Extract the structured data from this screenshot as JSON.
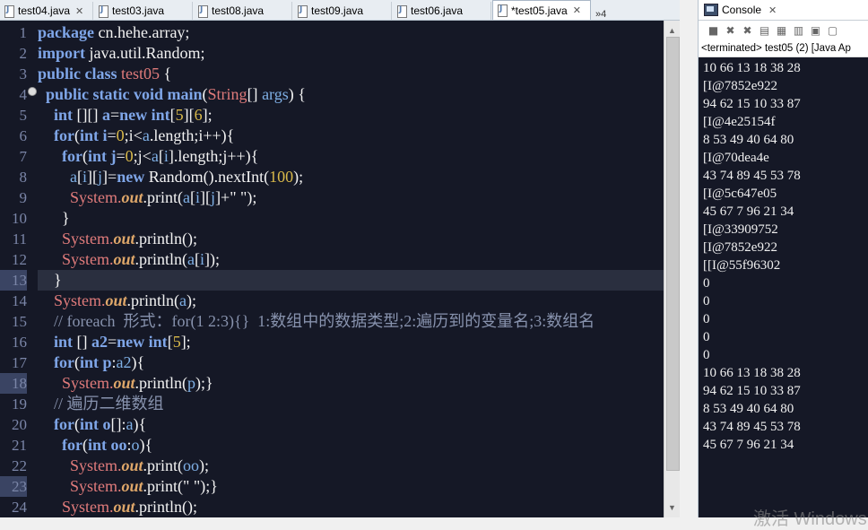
{
  "editor": {
    "tabs": [
      {
        "label": "test04.java",
        "close": "✕",
        "active": false
      },
      {
        "label": "test03.java",
        "close": "",
        "active": false
      },
      {
        "label": "test08.java",
        "close": "",
        "active": false
      },
      {
        "label": "test09.java",
        "close": "",
        "active": false
      },
      {
        "label": "test06.java",
        "close": "",
        "active": false
      },
      {
        "label": "*test05.java",
        "close": "✕",
        "active": true
      }
    ],
    "overflow_label": "»4",
    "line_numbers": [
      "1",
      "2",
      "3",
      "4",
      "5",
      "6",
      "7",
      "8",
      "9",
      "10",
      "11",
      "12",
      "13",
      "14",
      "15",
      "16",
      "17",
      "18",
      "19",
      "20",
      "21",
      "22",
      "23",
      "24"
    ],
    "lines": [
      [
        {
          "t": "package",
          "c": "kw"
        },
        {
          "t": " cn.hehe.array;",
          "c": "ty"
        }
      ],
      [
        {
          "t": "import",
          "c": "kw"
        },
        {
          "t": " java.util.Random;",
          "c": "ty"
        }
      ],
      [
        {
          "t": "public class",
          "c": "kw"
        },
        {
          "t": " ",
          "c": "ty"
        },
        {
          "t": "test05",
          "c": "cls"
        },
        {
          "t": " {",
          "c": "ty"
        }
      ],
      [
        {
          "t": "  ",
          "c": "ty"
        },
        {
          "t": "public static void",
          "c": "kw"
        },
        {
          "t": " main",
          "c": "kw"
        },
        {
          "t": "(",
          "c": "ty"
        },
        {
          "t": "String",
          "c": "cls"
        },
        {
          "t": "[] ",
          "c": "ty"
        },
        {
          "t": "args",
          "c": "var"
        },
        {
          "t": ") {",
          "c": "ty"
        }
      ],
      [
        {
          "t": "    ",
          "c": "ty"
        },
        {
          "t": "int",
          "c": "kw"
        },
        {
          "t": " [][] ",
          "c": "ty"
        },
        {
          "t": "a",
          "c": "kw"
        },
        {
          "t": "=",
          "c": "ty"
        },
        {
          "t": "new int",
          "c": "kw"
        },
        {
          "t": "[",
          "c": "ty"
        },
        {
          "t": "5",
          "c": "num"
        },
        {
          "t": "][",
          "c": "ty"
        },
        {
          "t": "6",
          "c": "num"
        },
        {
          "t": "];",
          "c": "ty"
        }
      ],
      [
        {
          "t": "    ",
          "c": "ty"
        },
        {
          "t": "for",
          "c": "kw"
        },
        {
          "t": "(",
          "c": "ty"
        },
        {
          "t": "int",
          "c": "kw"
        },
        {
          "t": " ",
          "c": "ty"
        },
        {
          "t": "i",
          "c": "kw"
        },
        {
          "t": "=",
          "c": "ty"
        },
        {
          "t": "0",
          "c": "num"
        },
        {
          "t": ";i<",
          "c": "ty"
        },
        {
          "t": "a",
          "c": "var"
        },
        {
          "t": ".length;i++){",
          "c": "ty"
        }
      ],
      [
        {
          "t": "      ",
          "c": "ty"
        },
        {
          "t": "for",
          "c": "kw"
        },
        {
          "t": "(",
          "c": "ty"
        },
        {
          "t": "int",
          "c": "kw"
        },
        {
          "t": " ",
          "c": "ty"
        },
        {
          "t": "j",
          "c": "kw"
        },
        {
          "t": "=",
          "c": "ty"
        },
        {
          "t": "0",
          "c": "num"
        },
        {
          "t": ";j<",
          "c": "ty"
        },
        {
          "t": "a",
          "c": "var"
        },
        {
          "t": "[",
          "c": "ty"
        },
        {
          "t": "i",
          "c": "var"
        },
        {
          "t": "].length;j++){",
          "c": "ty"
        }
      ],
      [
        {
          "t": "        ",
          "c": "ty"
        },
        {
          "t": "a",
          "c": "var"
        },
        {
          "t": "[",
          "c": "ty"
        },
        {
          "t": "i",
          "c": "var"
        },
        {
          "t": "][",
          "c": "ty"
        },
        {
          "t": "j",
          "c": "var"
        },
        {
          "t": "]=",
          "c": "ty"
        },
        {
          "t": "new",
          "c": "kw"
        },
        {
          "t": " Random().nextInt(",
          "c": "ty"
        },
        {
          "t": "100",
          "c": "num"
        },
        {
          "t": ");",
          "c": "ty"
        }
      ],
      [
        {
          "t": "        ",
          "c": "ty"
        },
        {
          "t": "System.",
          "c": "cls"
        },
        {
          "t": "out",
          "c": "fld"
        },
        {
          "t": ".print(",
          "c": "ty"
        },
        {
          "t": "a",
          "c": "var"
        },
        {
          "t": "[",
          "c": "ty"
        },
        {
          "t": "i",
          "c": "var"
        },
        {
          "t": "][",
          "c": "ty"
        },
        {
          "t": "j",
          "c": "var"
        },
        {
          "t": "]+\" \");",
          "c": "ty"
        }
      ],
      [
        {
          "t": "      }",
          "c": "ty"
        }
      ],
      [
        {
          "t": "      ",
          "c": "ty"
        },
        {
          "t": "System.",
          "c": "cls"
        },
        {
          "t": "out",
          "c": "fld"
        },
        {
          "t": ".println();",
          "c": "ty"
        }
      ],
      [
        {
          "t": "      ",
          "c": "ty"
        },
        {
          "t": "System.",
          "c": "cls"
        },
        {
          "t": "out",
          "c": "fld"
        },
        {
          "t": ".println(",
          "c": "ty"
        },
        {
          "t": "a",
          "c": "var"
        },
        {
          "t": "[",
          "c": "ty"
        },
        {
          "t": "i",
          "c": "var"
        },
        {
          "t": "]);",
          "c": "ty"
        }
      ],
      [
        {
          "t": "    }",
          "c": "ty"
        }
      ],
      [
        {
          "t": "    ",
          "c": "ty"
        },
        {
          "t": "System.",
          "c": "cls"
        },
        {
          "t": "out",
          "c": "fld"
        },
        {
          "t": ".println(",
          "c": "ty"
        },
        {
          "t": "a",
          "c": "var"
        },
        {
          "t": ");",
          "c": "ty"
        }
      ],
      [
        {
          "t": "    // ",
          "c": "cm"
        },
        {
          "t": "foreach",
          "c": "cm"
        },
        {
          "t": "  形式：for(1 2:3){}  1:数组中的数据类型;2:遍历到的变量名;3:数组名",
          "c": "cm"
        }
      ],
      [
        {
          "t": "    ",
          "c": "ty"
        },
        {
          "t": "int",
          "c": "kw"
        },
        {
          "t": " [] ",
          "c": "ty"
        },
        {
          "t": "a2",
          "c": "kw"
        },
        {
          "t": "=",
          "c": "ty"
        },
        {
          "t": "new int",
          "c": "kw"
        },
        {
          "t": "[",
          "c": "ty"
        },
        {
          "t": "5",
          "c": "num"
        },
        {
          "t": "];",
          "c": "ty"
        }
      ],
      [
        {
          "t": "    ",
          "c": "ty"
        },
        {
          "t": "for",
          "c": "kw"
        },
        {
          "t": "(",
          "c": "ty"
        },
        {
          "t": "int",
          "c": "kw"
        },
        {
          "t": " ",
          "c": "ty"
        },
        {
          "t": "p",
          "c": "kw"
        },
        {
          "t": ":",
          "c": "ty"
        },
        {
          "t": "a2",
          "c": "var"
        },
        {
          "t": "){",
          "c": "ty"
        }
      ],
      [
        {
          "t": "      ",
          "c": "ty"
        },
        {
          "t": "System.",
          "c": "cls"
        },
        {
          "t": "out",
          "c": "fld"
        },
        {
          "t": ".println(",
          "c": "ty"
        },
        {
          "t": "p",
          "c": "var"
        },
        {
          "t": ");}",
          "c": "ty"
        }
      ],
      [
        {
          "t": "    // 遍历二维数组",
          "c": "cm"
        }
      ],
      [
        {
          "t": "    ",
          "c": "ty"
        },
        {
          "t": "for",
          "c": "kw"
        },
        {
          "t": "(",
          "c": "ty"
        },
        {
          "t": "int",
          "c": "kw"
        },
        {
          "t": " ",
          "c": "ty"
        },
        {
          "t": "o",
          "c": "kw"
        },
        {
          "t": "[]:",
          "c": "ty"
        },
        {
          "t": "a",
          "c": "var"
        },
        {
          "t": "){",
          "c": "ty"
        }
      ],
      [
        {
          "t": "      ",
          "c": "ty"
        },
        {
          "t": "for",
          "c": "kw"
        },
        {
          "t": "(",
          "c": "ty"
        },
        {
          "t": "int",
          "c": "kw"
        },
        {
          "t": " ",
          "c": "ty"
        },
        {
          "t": "oo",
          "c": "kw"
        },
        {
          "t": ":",
          "c": "ty"
        },
        {
          "t": "o",
          "c": "var"
        },
        {
          "t": "){",
          "c": "ty"
        }
      ],
      [
        {
          "t": "        ",
          "c": "ty"
        },
        {
          "t": "System.",
          "c": "cls"
        },
        {
          "t": "out",
          "c": "fld"
        },
        {
          "t": ".print(",
          "c": "ty"
        },
        {
          "t": "oo",
          "c": "var"
        },
        {
          "t": ");",
          "c": "ty"
        }
      ],
      [
        {
          "t": "        ",
          "c": "ty"
        },
        {
          "t": "System.",
          "c": "cls"
        },
        {
          "t": "out",
          "c": "fld"
        },
        {
          "t": ".print(\" \");}",
          "c": "ty"
        }
      ],
      [
        {
          "t": "      ",
          "c": "ty"
        },
        {
          "t": "System.",
          "c": "cls"
        },
        {
          "t": "out",
          "c": "fld"
        },
        {
          "t": ".println();",
          "c": "ty"
        }
      ]
    ],
    "highlighted_line_numbers": [
      13,
      18,
      23
    ],
    "current_line": 13
  },
  "console": {
    "title": "Console",
    "close": "✕",
    "status": "<terminated> test05 (2) [Java Ap",
    "output": [
      "10 66 13 18 38 28",
      "[I@7852e922",
      "94 62 15 10 33 87",
      "[I@4e25154f",
      "8 53 49 40 64 80",
      "[I@70dea4e",
      "43 74 89 45 53 78",
      "[I@5c647e05",
      "45 67 7 96 21 34",
      "[I@33909752",
      "[I@7852e922",
      "[[I@55f96302",
      "0",
      "0",
      "0",
      "0",
      "0",
      "10 66 13 18 38 28",
      "94 62 15 10 33 87",
      "8 53 49 40 64 80",
      "43 74 89 45 53 78",
      "45 67 7 96 21 34"
    ]
  },
  "watermark": "激活 Windows"
}
